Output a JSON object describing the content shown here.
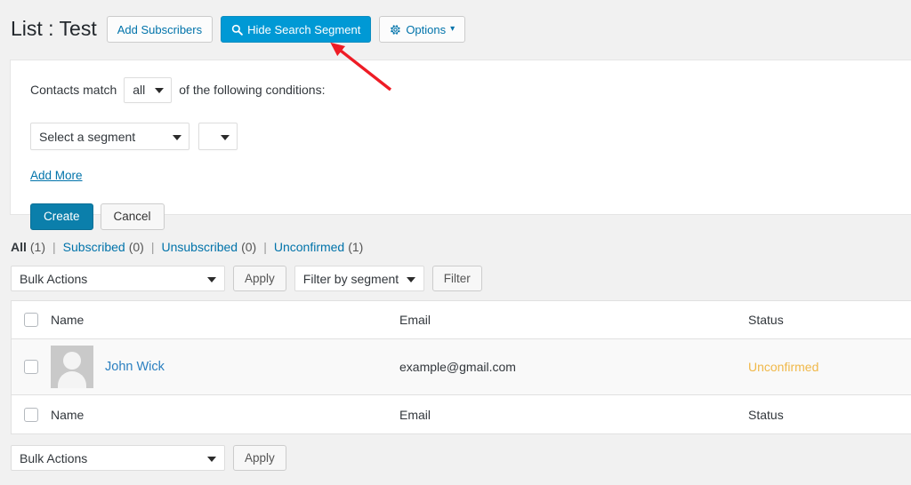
{
  "header": {
    "title": "List : Test",
    "buttons": [
      {
        "label": "Add Subscribers",
        "icon": "none",
        "style": "secondary"
      },
      {
        "label": "Hide Search Segment",
        "icon": "search-icon",
        "style": "primary"
      },
      {
        "label": "Options",
        "icon": "gear-icon",
        "style": "secondary",
        "caret": "▾"
      }
    ]
  },
  "segment_panel": {
    "prefix_text": "Contacts match",
    "match_value": "all",
    "suffix_text": "of the following conditions:",
    "segment_value": "Select a segment",
    "operator_value": "",
    "add_more_label": "Add More",
    "create_label": "Create",
    "cancel_label": "Cancel"
  },
  "status_links": [
    {
      "label": "All",
      "count": "(1)",
      "current": true
    },
    {
      "label": "Subscribed",
      "count": "(0)",
      "current": false
    },
    {
      "label": "Unsubscribed",
      "count": "(0)",
      "current": false
    },
    {
      "label": "Unconfirmed",
      "count": "(1)",
      "current": false
    }
  ],
  "separator": "|",
  "tablenav_top": {
    "bulk_actions_value": "Bulk Actions",
    "apply_label": "Apply",
    "filter_segment_value": "Filter by segment",
    "filter_label": "Filter"
  },
  "tablenav_bottom": {
    "bulk_actions_value": "Bulk Actions",
    "apply_label": "Apply"
  },
  "table": {
    "columns": {
      "name": "Name",
      "email": "Email",
      "status": "Status"
    },
    "rows": [
      {
        "name": "John Wick",
        "email": "example@gmail.com",
        "status": "Unconfirmed",
        "avatar": "default-avatar-icon"
      }
    ]
  },
  "colors": {
    "primary_button": "#0099d5",
    "create_button": "#0b7fab",
    "link": "#0073aa",
    "name_link": "#2a7fc0",
    "status_unconfirmed": "#f0b849",
    "page_background": "#f1f1f1",
    "annotation_arrow": "#ee1c25"
  },
  "annotation": {
    "type": "arrow",
    "points_to": "Hide Search Segment"
  }
}
